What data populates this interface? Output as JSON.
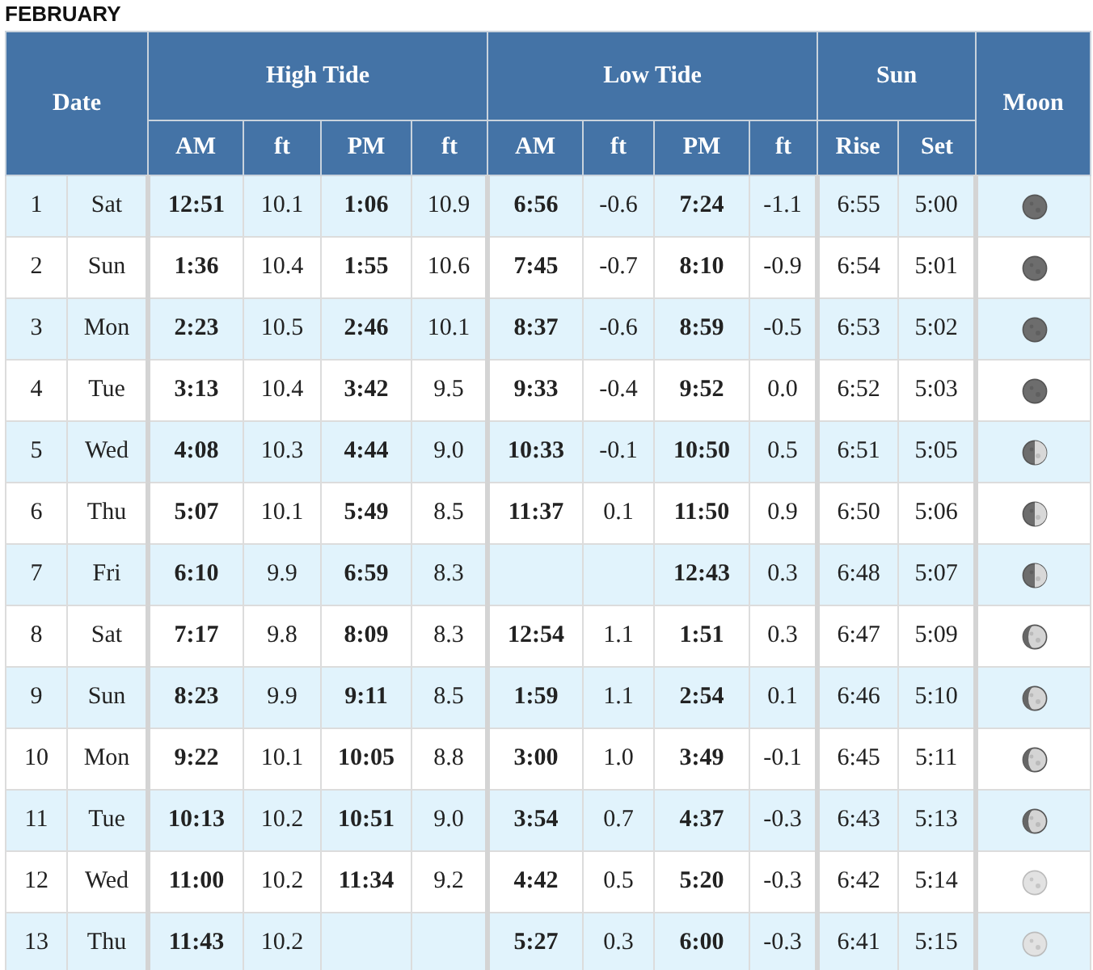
{
  "month": "FEBRUARY",
  "header": {
    "date": "Date",
    "high_tide": "High Tide",
    "low_tide": "Low Tide",
    "sun": "Sun",
    "moon": "Moon",
    "sub": [
      "AM",
      "ft",
      "PM",
      "ft",
      "AM",
      "ft",
      "PM",
      "ft",
      "Rise",
      "Set"
    ]
  },
  "rows": [
    {
      "day": "1",
      "weekday": "Sat",
      "high_am": "12:51",
      "high_am_ft": "10.1",
      "high_pm": "1:06",
      "high_pm_ft": "10.9",
      "low_am": "6:56",
      "low_am_ft": "-0.6",
      "low_pm": "7:24",
      "low_pm_ft": "-1.1",
      "rise": "6:55",
      "set": "5:00",
      "moon": {
        "kind": "dark"
      }
    },
    {
      "day": "2",
      "weekday": "Sun",
      "high_am": "1:36",
      "high_am_ft": "10.4",
      "high_pm": "1:55",
      "high_pm_ft": "10.6",
      "low_am": "7:45",
      "low_am_ft": "-0.7",
      "low_pm": "8:10",
      "low_pm_ft": "-0.9",
      "rise": "6:54",
      "set": "5:01",
      "moon": {
        "kind": "dark"
      }
    },
    {
      "day": "3",
      "weekday": "Mon",
      "high_am": "2:23",
      "high_am_ft": "10.5",
      "high_pm": "2:46",
      "high_pm_ft": "10.1",
      "low_am": "8:37",
      "low_am_ft": "-0.6",
      "low_pm": "8:59",
      "low_pm_ft": "-0.5",
      "rise": "6:53",
      "set": "5:02",
      "moon": {
        "kind": "dark"
      }
    },
    {
      "day": "4",
      "weekday": "Tue",
      "high_am": "3:13",
      "high_am_ft": "10.4",
      "high_pm": "3:42",
      "high_pm_ft": "9.5",
      "low_am": "9:33",
      "low_am_ft": "-0.4",
      "low_pm": "9:52",
      "low_pm_ft": "0.0",
      "rise": "6:52",
      "set": "5:03",
      "moon": {
        "kind": "dark"
      }
    },
    {
      "day": "5",
      "weekday": "Wed",
      "high_am": "4:08",
      "high_am_ft": "10.3",
      "high_pm": "4:44",
      "high_pm_ft": "9.0",
      "low_am": "10:33",
      "low_am_ft": "-0.1",
      "low_pm": "10:50",
      "low_pm_ft": "0.5",
      "rise": "6:51",
      "set": "5:05",
      "moon": {
        "kind": "half"
      }
    },
    {
      "day": "6",
      "weekday": "Thu",
      "high_am": "5:07",
      "high_am_ft": "10.1",
      "high_pm": "5:49",
      "high_pm_ft": "8.5",
      "low_am": "11:37",
      "low_am_ft": "0.1",
      "low_pm": "11:50",
      "low_pm_ft": "0.9",
      "rise": "6:50",
      "set": "5:06",
      "moon": {
        "kind": "half"
      }
    },
    {
      "day": "7",
      "weekday": "Fri",
      "high_am": "6:10",
      "high_am_ft": "9.9",
      "high_pm": "6:59",
      "high_pm_ft": "8.3",
      "low_pm": "12:43",
      "low_pm_ft": "0.3",
      "rise": "6:48",
      "set": "5:07",
      "moon": {
        "kind": "half"
      }
    },
    {
      "day": "8",
      "weekday": "Sat",
      "high_am": "7:17",
      "high_am_ft": "9.8",
      "high_pm": "8:09",
      "high_pm_ft": "8.3",
      "low_am": "12:54",
      "low_am_ft": "1.1",
      "low_pm": "1:51",
      "low_pm_ft": "0.3",
      "rise": "6:47",
      "set": "5:09",
      "moon": {
        "kind": "light"
      }
    },
    {
      "day": "9",
      "weekday": "Sun",
      "high_am": "8:23",
      "high_am_ft": "9.9",
      "high_pm": "9:11",
      "high_pm_ft": "8.5",
      "low_am": "1:59",
      "low_am_ft": "1.1",
      "low_pm": "2:54",
      "low_pm_ft": "0.1",
      "rise": "6:46",
      "set": "5:10",
      "moon": {
        "kind": "light"
      }
    },
    {
      "day": "10",
      "weekday": "Mon",
      "high_am": "9:22",
      "high_am_ft": "10.1",
      "high_pm": "10:05",
      "high_pm_ft": "8.8",
      "low_am": "3:00",
      "low_am_ft": "1.0",
      "low_pm": "3:49",
      "low_pm_ft": "-0.1",
      "rise": "6:45",
      "set": "5:11",
      "moon": {
        "kind": "light"
      }
    },
    {
      "day": "11",
      "weekday": "Tue",
      "high_am": "10:13",
      "high_am_ft": "10.2",
      "high_pm": "10:51",
      "high_pm_ft": "9.0",
      "low_am": "3:54",
      "low_am_ft": "0.7",
      "low_pm": "4:37",
      "low_pm_ft": "-0.3",
      "rise": "6:43",
      "set": "5:13",
      "moon": {
        "kind": "light"
      }
    },
    {
      "day": "12",
      "weekday": "Wed",
      "high_am": "11:00",
      "high_am_ft": "10.2",
      "high_pm": "11:34",
      "high_pm_ft": "9.2",
      "low_am": "4:42",
      "low_am_ft": "0.5",
      "low_pm": "5:20",
      "low_pm_ft": "-0.3",
      "rise": "6:42",
      "set": "5:14",
      "moon": {
        "kind": "pale"
      }
    },
    {
      "day": "13",
      "weekday": "Thu",
      "high_am": "11:43",
      "high_am_ft": "10.2",
      "low_am": "5:27",
      "low_am_ft": "0.3",
      "low_pm": "6:00",
      "low_pm_ft": "-0.3",
      "rise": "6:41",
      "set": "5:15",
      "moon": {
        "kind": "pale"
      }
    }
  ]
}
